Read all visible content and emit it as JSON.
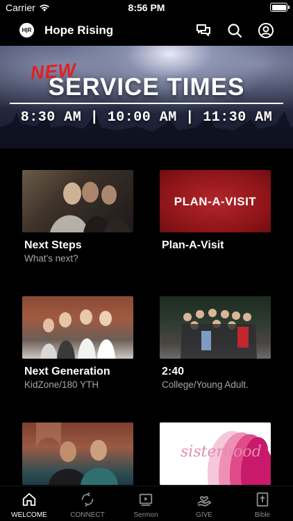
{
  "status_bar": {
    "carrier": "Carrier",
    "time": "8:56 PM"
  },
  "header": {
    "logo_text": "H|R",
    "title": "Hope Rising"
  },
  "banner": {
    "new_text": "NEW",
    "title": "SERVICE TIMES",
    "times": "8:30 AM | 10:00 AM | 11:30 AM"
  },
  "cards": [
    {
      "title": "Next Steps",
      "subtitle": "What's next?"
    },
    {
      "title": "Plan-A-Visit",
      "subtitle": "",
      "image_text": "PLAN-A-VISIT"
    },
    {
      "title": "Next Generation",
      "subtitle": "KidZone/180 YTH"
    },
    {
      "title": "2:40",
      "subtitle": "College/Young Adult."
    },
    {
      "title": "",
      "subtitle": ""
    },
    {
      "title": "",
      "subtitle": "",
      "image_text": "sisterhood"
    }
  ],
  "tabs": [
    {
      "label": "WELCOME",
      "icon": "home-icon",
      "active": true
    },
    {
      "label": "CONNECT",
      "icon": "connect-icon",
      "active": false
    },
    {
      "label": "Sermon",
      "icon": "play-icon",
      "active": false
    },
    {
      "label": "GIVE",
      "icon": "give-icon",
      "active": false
    },
    {
      "label": "Bible",
      "icon": "bible-icon",
      "active": false
    }
  ],
  "colors": {
    "background": "#000000",
    "new_accent": "#e02020",
    "plan_visit_red": "#a0181d",
    "subtitle_gray": "#a7a7a7",
    "tab_inactive": "#8e8e93"
  }
}
